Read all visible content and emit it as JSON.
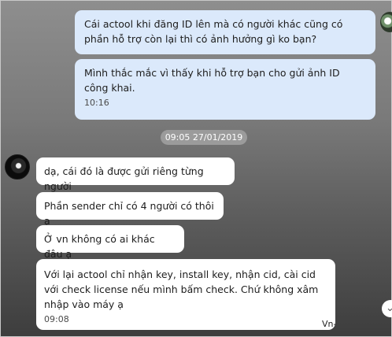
{
  "messages_out": [
    {
      "text": "Cái actool khi đăng ID lên mà có người khác cũng có phần hỗ trợ còn lại thì có ảnh hưởng gì ko bạn?"
    },
    {
      "text": "Mình thắc mắc vì thấy khi hỗ trợ bạn cho gửi ảnh ID công khai.",
      "time": "10:16"
    }
  ],
  "date_separator": "09:05 27/01/2019",
  "messages_in": [
    {
      "text": "dạ, cái đó là được gửi riêng từng người"
    },
    {
      "text": "Phần sender chỉ có 4 người có thôi ạ"
    },
    {
      "text": "Ở vn không có ai khác đâu ạ"
    },
    {
      "text": "Với lại actool chỉ nhận key, install key, nhận cid, cài cid với check license nếu mình bấm check. Chứ không xâm nhập vào máy ạ",
      "time": "09:08"
    }
  ],
  "watermark": "Vn-",
  "icons": {
    "scroll_down": "chevron-down-icon",
    "avatar": "contact-avatar"
  },
  "colors": {
    "outgoing_bubble": "#dbe9fb",
    "incoming_bubble": "#ffffff",
    "date_pill": "#9b9b9b"
  }
}
